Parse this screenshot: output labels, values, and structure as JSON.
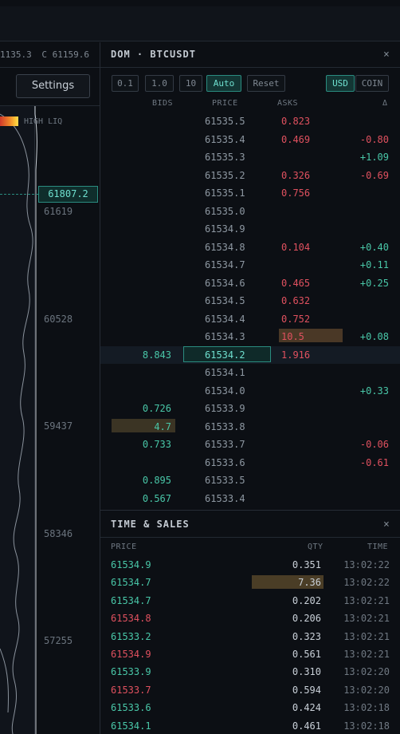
{
  "chart": {
    "ohlc": [
      "1135.3",
      "C 61159.6"
    ],
    "settings_label": "Settings",
    "liq_label": "HIGH LIQ",
    "current_price": "61807.2",
    "axis_labels": [
      "61619",
      "60528",
      "59437",
      "58346",
      "57255"
    ]
  },
  "dom": {
    "title": "DOM · BTCUSDT",
    "close": "×",
    "tick_options": [
      "0.1",
      "1.0",
      "10"
    ],
    "auto_label": "Auto",
    "reset_label": "Reset",
    "unit_options": [
      "USD",
      "COIN"
    ],
    "columns": {
      "bids": "BIDS",
      "price": "PRICE",
      "asks": "ASKS",
      "delta": "Δ"
    },
    "rows": [
      {
        "bid": "",
        "price": "61535.5",
        "ask": "0.823",
        "delta": ""
      },
      {
        "bid": "",
        "price": "61535.4",
        "ask": "0.469",
        "delta": "-0.80"
      },
      {
        "bid": "",
        "price": "61535.3",
        "ask": "",
        "delta": "+1.09"
      },
      {
        "bid": "",
        "price": "61535.2",
        "ask": "0.326",
        "delta": "-0.69"
      },
      {
        "bid": "",
        "price": "61535.1",
        "ask": "0.756",
        "delta": ""
      },
      {
        "bid": "",
        "price": "61535.0",
        "ask": "",
        "delta": ""
      },
      {
        "bid": "",
        "price": "61534.9",
        "ask": "",
        "delta": ""
      },
      {
        "bid": "",
        "price": "61534.8",
        "ask": "0.104",
        "delta": "+0.40"
      },
      {
        "bid": "",
        "price": "61534.7",
        "ask": "",
        "delta": "+0.11"
      },
      {
        "bid": "",
        "price": "61534.6",
        "ask": "0.465",
        "delta": "+0.25"
      },
      {
        "bid": "",
        "price": "61534.5",
        "ask": "0.632",
        "delta": ""
      },
      {
        "bid": "",
        "price": "61534.4",
        "ask": "0.752",
        "delta": ""
      },
      {
        "bid": "",
        "price": "61534.3",
        "ask": "10.5",
        "delta": "+0.08"
      },
      {
        "bid": "8.843",
        "price": "61534.2",
        "ask": "1.916",
        "delta": ""
      },
      {
        "bid": "",
        "price": "61534.1",
        "ask": "",
        "delta": ""
      },
      {
        "bid": "",
        "price": "61534.0",
        "ask": "",
        "delta": "+0.33"
      },
      {
        "bid": "0.726",
        "price": "61533.9",
        "ask": "",
        "delta": ""
      },
      {
        "bid": "4.7",
        "price": "61533.8",
        "ask": "",
        "delta": ""
      },
      {
        "bid": "0.733",
        "price": "61533.7",
        "ask": "",
        "delta": "-0.06"
      },
      {
        "bid": "",
        "price": "61533.6",
        "ask": "",
        "delta": "-0.61"
      },
      {
        "bid": "0.895",
        "price": "61533.5",
        "ask": "",
        "delta": ""
      },
      {
        "bid": "0.567",
        "price": "61533.4",
        "ask": "",
        "delta": ""
      }
    ]
  },
  "ts": {
    "title": "TIME & SALES",
    "close": "×",
    "columns": {
      "price": "PRICE",
      "qty": "QTY",
      "time": "TIME"
    },
    "rows": [
      {
        "price": "61534.9",
        "side": "buy",
        "qty": "0.351",
        "time": "13:02:22"
      },
      {
        "price": "61534.7",
        "side": "buy",
        "qty": "7.36",
        "time": "13:02:22"
      },
      {
        "price": "61534.7",
        "side": "buy",
        "qty": "0.202",
        "time": "13:02:21"
      },
      {
        "price": "61534.8",
        "side": "sell",
        "qty": "0.206",
        "time": "13:02:21"
      },
      {
        "price": "61533.2",
        "side": "buy",
        "qty": "0.323",
        "time": "13:02:21"
      },
      {
        "price": "61534.9",
        "side": "sell",
        "qty": "0.561",
        "time": "13:02:21"
      },
      {
        "price": "61533.9",
        "side": "buy",
        "qty": "0.310",
        "time": "13:02:20"
      },
      {
        "price": "61533.7",
        "side": "sell",
        "qty": "0.594",
        "time": "13:02:20"
      },
      {
        "price": "61533.6",
        "side": "buy",
        "qty": "0.424",
        "time": "13:02:18"
      },
      {
        "price": "61534.1",
        "side": "buy",
        "qty": "0.461",
        "time": "13:02:18"
      }
    ]
  },
  "colors": {
    "buy": "#49c7a8",
    "sell": "#e0515f",
    "accent": "#2a8c80",
    "large_size_highlight": "#4a3826"
  }
}
